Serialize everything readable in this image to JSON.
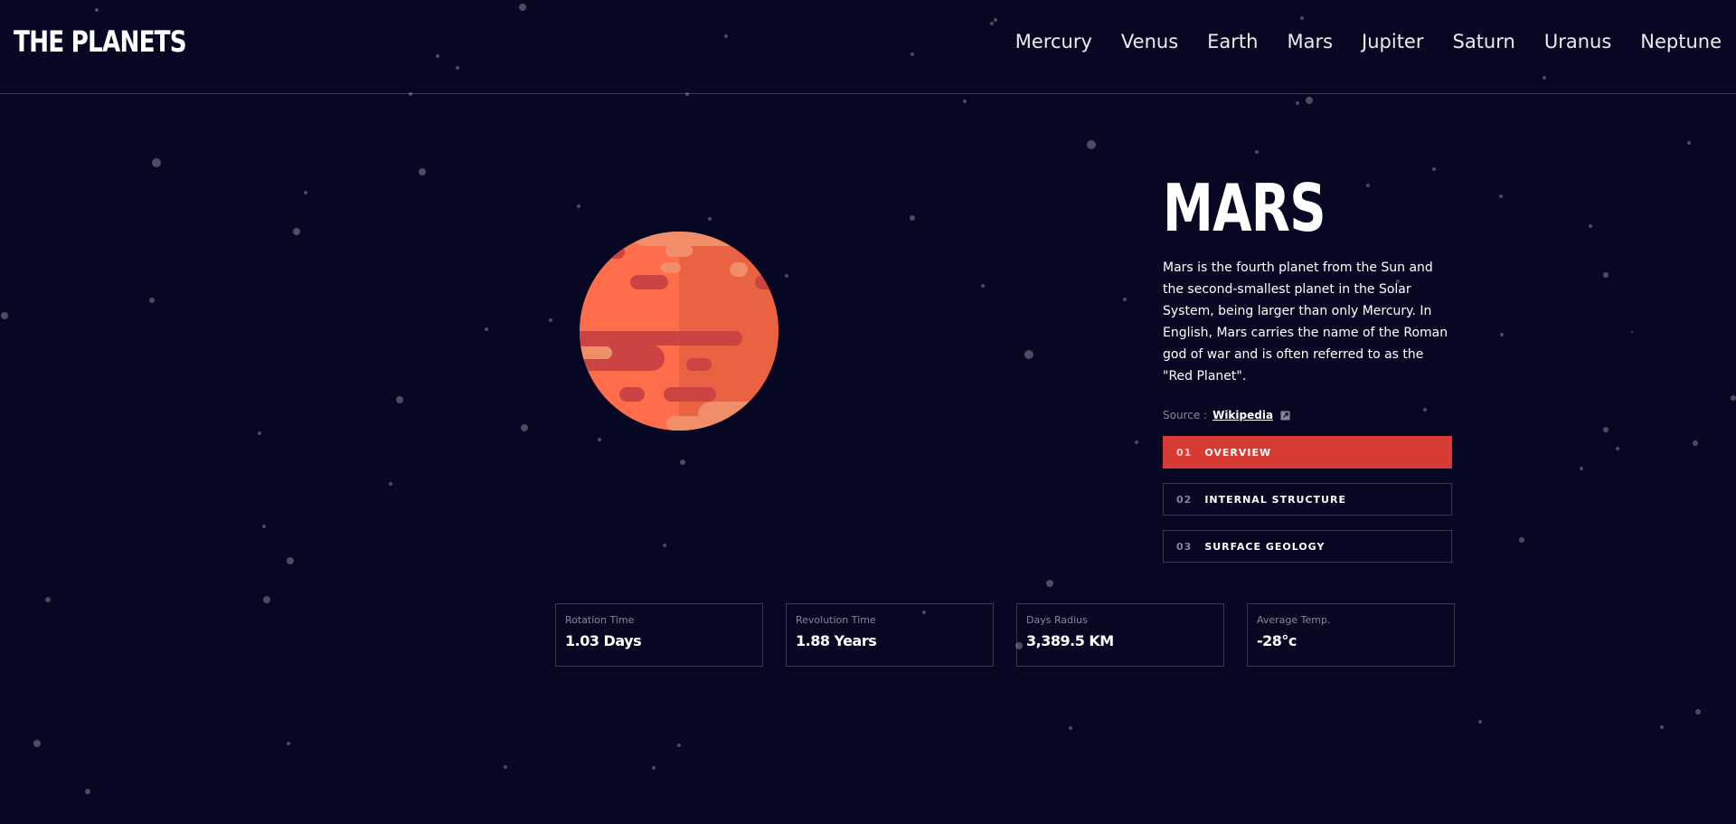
{
  "app": {
    "logo": "THE PLANETS"
  },
  "nav": {
    "items": [
      {
        "label": "Mercury"
      },
      {
        "label": "Venus"
      },
      {
        "label": "Earth"
      },
      {
        "label": "Mars"
      },
      {
        "label": "Jupiter"
      },
      {
        "label": "Saturn"
      },
      {
        "label": "Uranus"
      },
      {
        "label": "Neptune"
      }
    ]
  },
  "planet": {
    "name": "MARS",
    "description": "Mars is the fourth planet from the Sun and the second-smallest planet in the Solar System, being larger than only Mercury. In English, Mars carries the name of the Roman god of war and is often referred to as the \"Red Planet\".",
    "source_prefix": "Source :",
    "source_link": "Wikipedia",
    "image_icon": "mars-planet-icon",
    "ext_link_icon": "external-link-icon"
  },
  "tabs": [
    {
      "num": "01",
      "label": "OVERVIEW",
      "active": true
    },
    {
      "num": "02",
      "label": "INTERNAL STRUCTURE",
      "active": false
    },
    {
      "num": "03",
      "label": "SURFACE GEOLOGY",
      "active": false
    }
  ],
  "stats": [
    {
      "label": "Rotation Time",
      "value": "1.03 Days"
    },
    {
      "label": "Revolution Time",
      "value": "1.88 Years"
    },
    {
      "label": "Days Radius",
      "value": "3,389.5 KM"
    },
    {
      "label": "Average Temp.",
      "value": "-28°c"
    }
  ],
  "colors": {
    "background": "#070724",
    "accent": "#D83A34",
    "planet_base": "#FF6D4A",
    "planet_shade": "#E96343",
    "planet_stripe": "#CB4343",
    "planet_highlight": "#F08E6A"
  }
}
